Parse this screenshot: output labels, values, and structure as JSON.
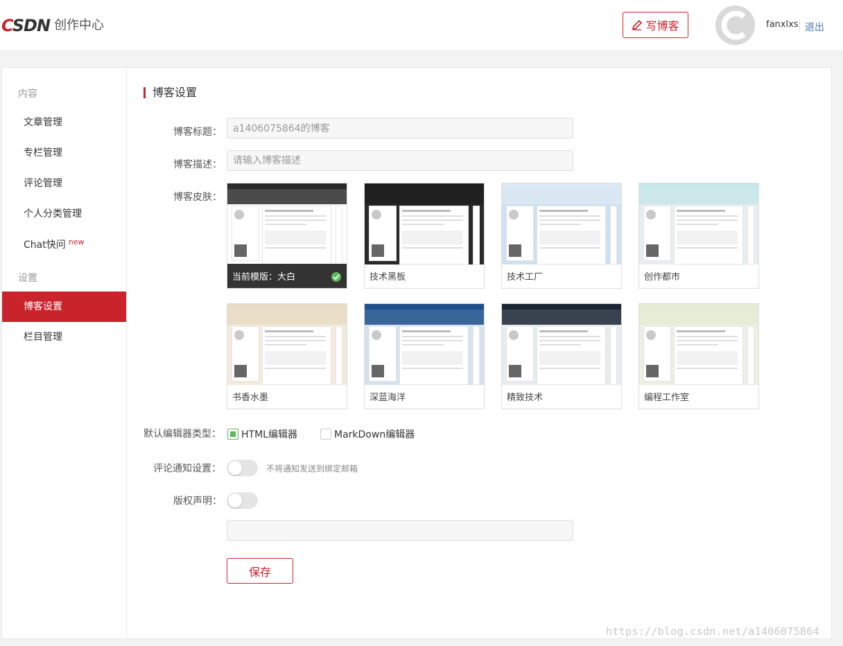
{
  "header": {
    "logo_mark_c": "C",
    "logo_mark_rest": "SDN",
    "logo_text": "创作中心",
    "write_label": "写博客",
    "username": "fanxlxs",
    "logout_label": "退出"
  },
  "sidebar": {
    "group_content": "内容",
    "items_content": [
      {
        "label": "文章管理"
      },
      {
        "label": "专栏管理"
      },
      {
        "label": "评论管理"
      },
      {
        "label": "个人分类管理"
      },
      {
        "label": "Chat快问",
        "badge": "new"
      }
    ],
    "group_settings": "设置",
    "items_settings": [
      {
        "label": "博客设置",
        "active": true
      },
      {
        "label": "栏目管理"
      }
    ]
  },
  "main": {
    "title": "博客设置",
    "blog_title_label": "博客标题：",
    "blog_title_value": "a1406075864的博客",
    "blog_desc_label": "博客描述：",
    "blog_desc_placeholder": "请输入博客描述",
    "skin_label": "博客皮肤：",
    "skins": [
      {
        "name": "当前模版：大白",
        "current": true,
        "header_color": "#2b2b2b",
        "body_color": "#ffffff"
      },
      {
        "name": "技术黑板",
        "header_color": "#1e1e1e",
        "body_color": "#2a2a2a"
      },
      {
        "name": "技术工厂",
        "header_color": "#dce9f5",
        "body_color": "#cfe0f0"
      },
      {
        "name": "创作都市",
        "header_color": "#c7e6ea",
        "body_color": "#e8eef0"
      },
      {
        "name": "书香水墨",
        "header_color": "#e8dcc4",
        "body_color": "#f3ecdc"
      },
      {
        "name": "深蓝海洋",
        "header_color": "#1d4f8c",
        "body_color": "#d6e3ef"
      },
      {
        "name": "精致技术",
        "header_color": "#1a2533",
        "body_color": "#e9ecef"
      },
      {
        "name": "编程工作室",
        "header_color": "#e4ecd4",
        "body_color": "#ecefe2"
      }
    ],
    "editor_label": "默认编辑器类型：",
    "editor_html": "HTML编辑器",
    "editor_md": "MarkDown编辑器",
    "comment_notify_label": "评论通知设置：",
    "comment_notify_hint": "不将通知发送到绑定邮箱",
    "copyright_label": "版权声明：",
    "save_label": "保存"
  },
  "watermark": "https://blog.csdn.net/a1406075864",
  "colors": {
    "brand": "#c9232c",
    "success": "#5bb85b",
    "link": "#4a7aa8"
  }
}
